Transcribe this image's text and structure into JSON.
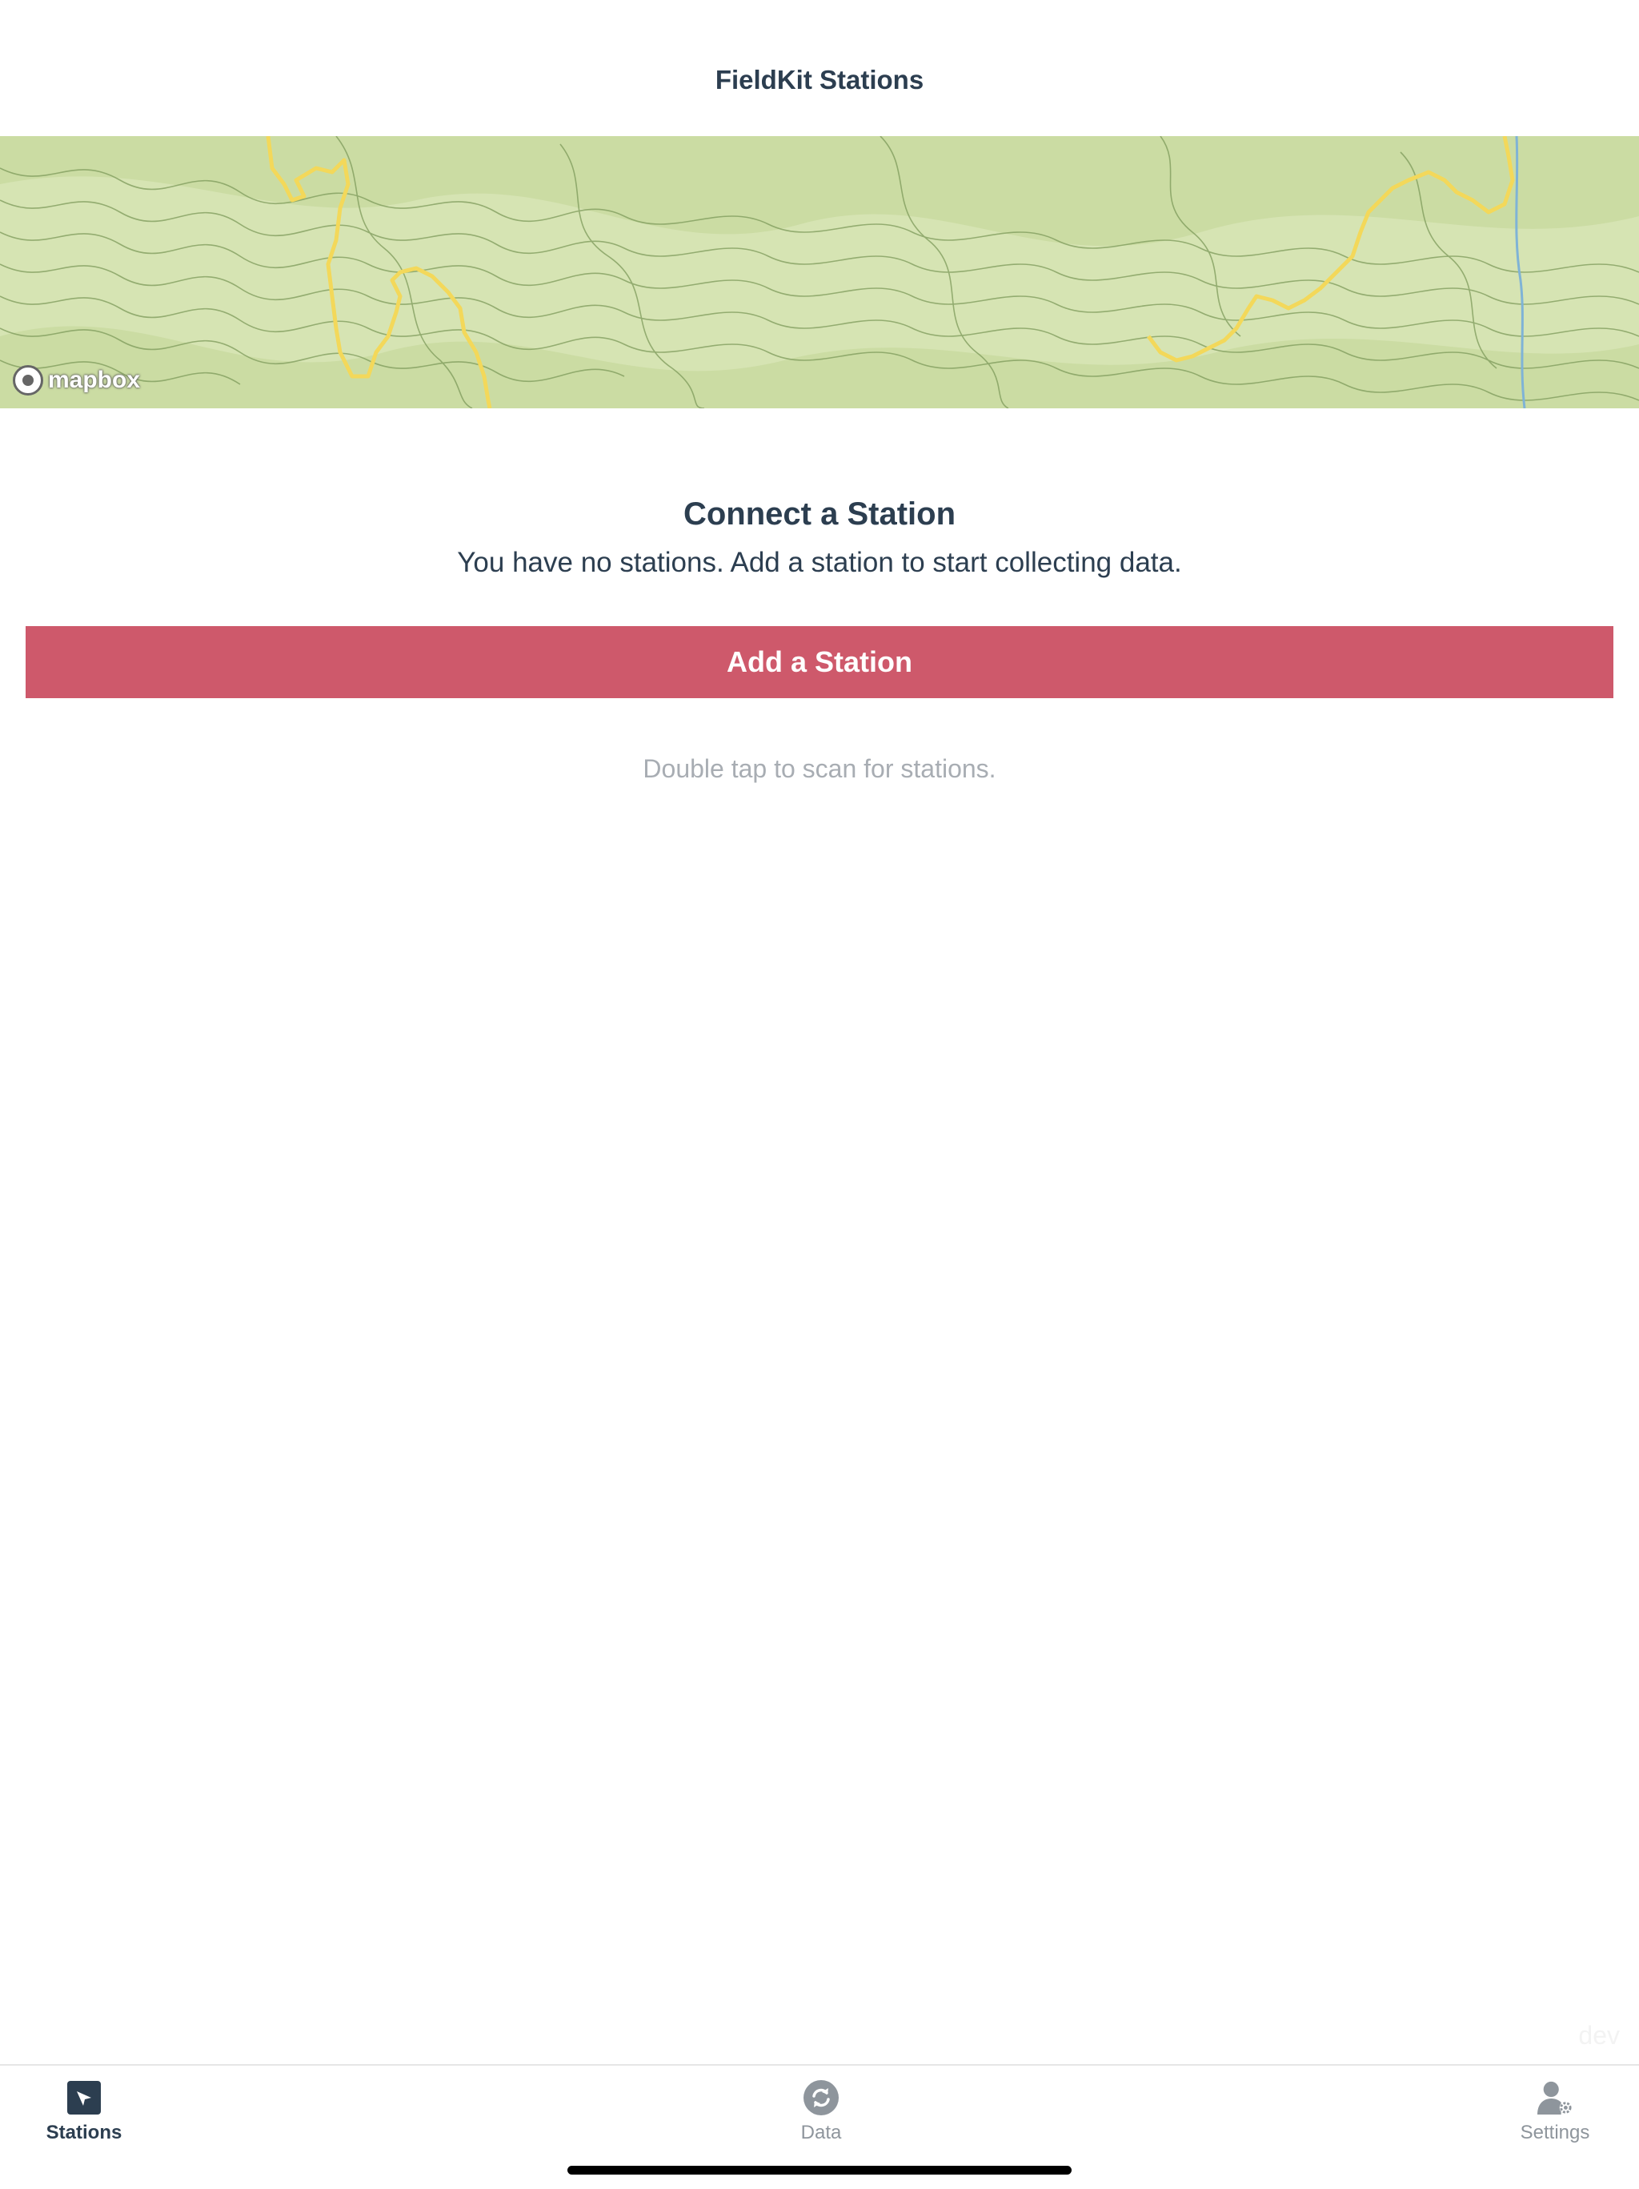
{
  "header": {
    "title": "FieldKit Stations"
  },
  "map": {
    "attribution": "mapbox",
    "colors": {
      "base": "#d9e6b9",
      "contour": "#7d9a5a",
      "trail": "#f3d85a",
      "water": "#7fb3d6"
    }
  },
  "empty_state": {
    "title": "Connect a Station",
    "subtitle": "You have no stations. Add a station to start collecting data.",
    "button_label": "Add a Station",
    "hint": "Double tap to scan for stations."
  },
  "dev_badge": "dev",
  "tabs": [
    {
      "label": "Stations",
      "icon": "compass-icon",
      "active": true
    },
    {
      "label": "Data",
      "icon": "sync-icon",
      "active": false
    },
    {
      "label": "Settings",
      "icon": "user-gear-icon",
      "active": false
    }
  ],
  "colors": {
    "primary_text": "#2c3e50",
    "accent": "#ce596b",
    "hint_text": "#a8adb3",
    "inactive_tab": "#8e959c"
  }
}
